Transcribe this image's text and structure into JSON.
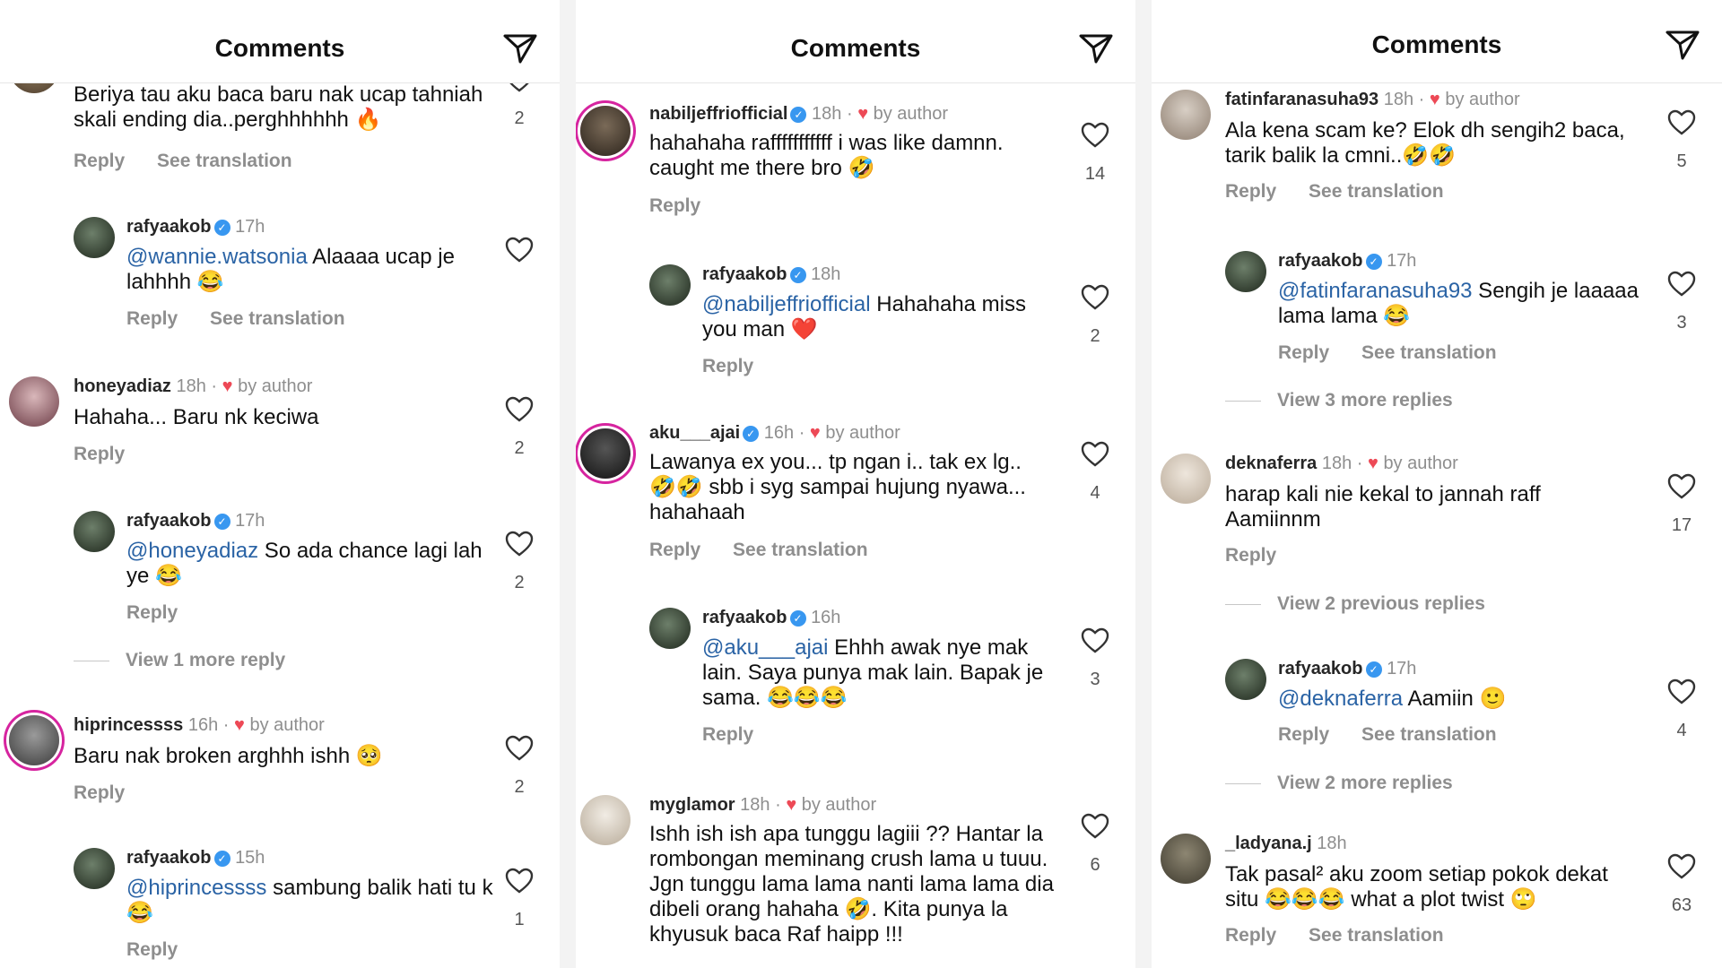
{
  "panels": [
    {
      "title": "Comments",
      "comments": [
        {
          "user": "",
          "time": "",
          "by_author": false,
          "text": "Beriya tau aku baca baru nak ucap tahniah skali ending dia..perghhhhhh 🔥",
          "mention": "",
          "likes": "2",
          "reply": "Reply",
          "translation": "See translation"
        },
        {
          "user": "rafyaakob",
          "time": "17h",
          "by_author": false,
          "text": " Alaaaa ucap je lahhhh 😂",
          "mention": "@wannie.watsonia",
          "likes": "",
          "reply": "Reply",
          "translation": "See translation"
        },
        {
          "user": "honeyadiaz",
          "time": "18h",
          "by_author": true,
          "text": "Hahaha... Baru nk keciwa",
          "mention": "",
          "likes": "2",
          "reply": "Reply",
          "translation": ""
        },
        {
          "user": "rafyaakob",
          "time": "17h",
          "by_author": false,
          "text": " So ada chance lagi lah ye 😂",
          "mention": "@honeyadiaz",
          "likes": "2",
          "reply": "Reply",
          "translation": ""
        },
        {
          "user": "hiprincessss",
          "time": "16h",
          "by_author": true,
          "text": "Baru nak broken arghhh ishh 🥺",
          "mention": "",
          "likes": "2",
          "reply": "Reply",
          "translation": ""
        },
        {
          "user": "rafyaakob",
          "time": "15h",
          "by_author": false,
          "text": " sambung balik hati tu k 😂",
          "mention": "@hiprincessss",
          "likes": "1",
          "reply": "Reply",
          "translation": ""
        }
      ],
      "view_more": "View 1 more reply"
    },
    {
      "title": "Comments",
      "comments": [
        {
          "user": "nabiljeffriofficial",
          "time": "18h",
          "by_author": true,
          "text": "hahahaha rafffffffffff i was like damnn. caught me there bro 🤣",
          "mention": "",
          "likes": "14",
          "reply": "Reply",
          "translation": ""
        },
        {
          "user": "rafyaakob",
          "time": "18h",
          "by_author": false,
          "text": " Hahahaha miss you man ❤️",
          "mention": "@nabiljeffriofficial",
          "likes": "2",
          "reply": "Reply",
          "translation": ""
        },
        {
          "user": "aku___ajai",
          "time": "16h",
          "by_author": true,
          "text": "Lawanya ex you... tp ngan i.. tak ex lg.. 🤣🤣 sbb i syg sampai hujung nyawa... hahahaah",
          "mention": "",
          "likes": "4",
          "reply": "Reply",
          "translation": "See translation"
        },
        {
          "user": "rafyaakob",
          "time": "16h",
          "by_author": false,
          "text": " Ehhh awak nye mak lain. Saya punya mak lain. Bapak je sama. 😂😂😂",
          "mention": "@aku___ajai",
          "likes": "3",
          "reply": "Reply",
          "translation": ""
        },
        {
          "user": "myglamor",
          "time": "18h",
          "by_author": true,
          "text": "Ishh ish ish apa tunggu lagiii ?? Hantar la rombongan meminang crush lama u tuuu. Jgn tunggu lama lama nanti lama lama dia dibeli orang hahaha 🤣. Kita punya la khyusuk baca Raf haipp !!!",
          "mention": "",
          "likes": "6",
          "reply": "",
          "translation": ""
        }
      ]
    },
    {
      "title": "Comments",
      "comments": [
        {
          "user": "fatinfaranasuha93",
          "time": "18h",
          "by_author": true,
          "text": "Ala kena scam ke? Elok dh sengih2 baca, tarik balik la cmni..🤣🤣",
          "mention": "",
          "likes": "5",
          "reply": "Reply",
          "translation": "See translation"
        },
        {
          "user": "rafyaakob",
          "time": "17h",
          "by_author": false,
          "text": " Sengih je laaaaa lama lama 😂",
          "mention": "@fatinfaranasuha93",
          "likes": "3",
          "reply": "Reply",
          "translation": "See translation"
        },
        {
          "user": "deknaferra",
          "time": "18h",
          "by_author": true,
          "text": "harap kali nie kekal to jannah raff Aamiinnm",
          "mention": "",
          "likes": "17",
          "reply": "Reply",
          "translation": ""
        },
        {
          "user": "rafyaakob",
          "time": "17h",
          "by_author": false,
          "text": " Aamiin 🙂",
          "mention": "@deknaferra",
          "likes": "4",
          "reply": "Reply",
          "translation": "See translation"
        },
        {
          "user": "_ladyana.j",
          "time": "18h",
          "by_author": false,
          "text": "Tak pasal² aku zoom setiap pokok dekat situ 😂😂😂 what a plot twist 🙄",
          "mention": "",
          "likes": "63",
          "reply": "Reply",
          "translation": "See translation"
        }
      ],
      "view_more_1": "View 3 more replies",
      "view_previous": "View 2 previous replies",
      "view_more_2": "View 2 more replies"
    }
  ],
  "by_author_label": "by author",
  "icons": {
    "send": "send-icon",
    "like": "heart-outline-icon",
    "verified": "verified-badge-icon",
    "author_heart": "red-heart-icon"
  },
  "colors": {
    "mention": "#2a63a5",
    "verified": "#3897f0",
    "heart": "#ed4956",
    "muted": "#8e8e8e"
  }
}
